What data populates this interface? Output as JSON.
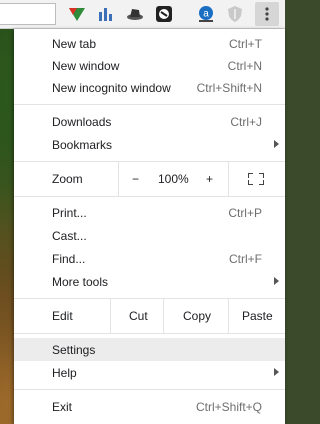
{
  "menu": {
    "new_tab": {
      "label": "New tab",
      "shortcut": "Ctrl+T"
    },
    "new_window": {
      "label": "New window",
      "shortcut": "Ctrl+N"
    },
    "new_incognito": {
      "label": "New incognito window",
      "shortcut": "Ctrl+Shift+N"
    },
    "downloads": {
      "label": "Downloads",
      "shortcut": "Ctrl+J"
    },
    "bookmarks": {
      "label": "Bookmarks"
    },
    "zoom": {
      "label": "Zoom",
      "minus": "−",
      "level": "100%",
      "plus": "+"
    },
    "print": {
      "label": "Print...",
      "shortcut": "Ctrl+P"
    },
    "cast": {
      "label": "Cast..."
    },
    "find": {
      "label": "Find...",
      "shortcut": "Ctrl+F"
    },
    "more_tools": {
      "label": "More tools"
    },
    "edit": {
      "label": "Edit",
      "cut": "Cut",
      "copy": "Copy",
      "paste": "Paste"
    },
    "settings": {
      "label": "Settings"
    },
    "help": {
      "label": "Help"
    },
    "exit": {
      "label": "Exit",
      "shortcut": "Ctrl+Shift+Q"
    }
  },
  "toolbar": {
    "extensions": [
      "mail-triangle-icon",
      "bar-chart-icon",
      "hat-icon",
      "shield-dark-icon",
      "amazon-icon",
      "shield-gray-icon"
    ],
    "menu_icon": "three-dots-vertical-icon"
  }
}
